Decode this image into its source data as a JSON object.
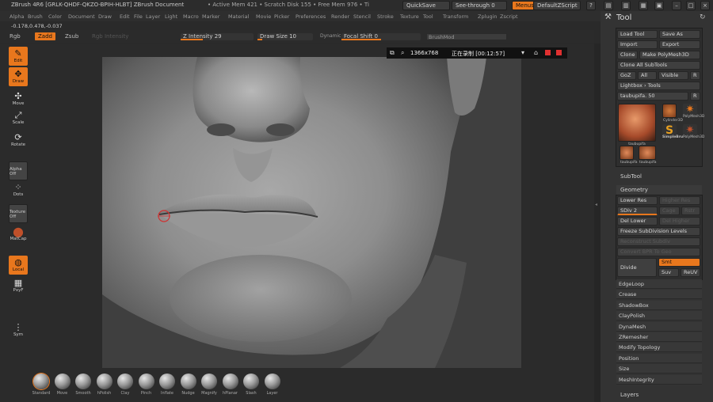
{
  "titlebar": {
    "title": "ZBrush 4R6 [GRLK-QHDF-QKZO-BPIH-HLBT]   ZBrush Document",
    "stats": "• Active Mem 421 • Scratch Disk 155 • Free Mem 976 • Ti",
    "quicksave": "QuickSave",
    "seethrough": "See-through  0",
    "menus": "Menus",
    "script": "DefaultZScript"
  },
  "menubar": [
    "Alpha",
    "Brush",
    "Color",
    "Document",
    "Draw",
    "Edit",
    "File",
    "Layer",
    "Light",
    "Macro",
    "Marker",
    "Material",
    "Movie",
    "Picker",
    "Preferences",
    "Render",
    "Stencil",
    "Stroke",
    "Texture",
    "Tool",
    "Transform",
    "Zplugin",
    "Zscript"
  ],
  "coords": "-0.178,0.478,-0.037",
  "toolbar2": {
    "rgb": "Rgb",
    "zadd": "Zadd",
    "zsub": "Zsub",
    "rgb_intensity": "Rgb Intensity",
    "z_intensity": "Z Intensity 29",
    "draw_size": "Draw Size 10",
    "dynamic": "Dynamic",
    "focal_shift": "Focal Shift 0",
    "brush_input": "BrushMod"
  },
  "leftshelf": [
    {
      "label": "Edit",
      "icon": "edit-icon",
      "icon_char": "✎",
      "active": true
    },
    {
      "label": "Draw",
      "icon": "draw-icon",
      "icon_char": "✥",
      "active": true
    },
    {
      "label": "Move",
      "icon": "move-icon",
      "icon_char": "✣",
      "active": false
    },
    {
      "label": "Scale",
      "icon": "scale-icon",
      "icon_char": "⤢",
      "active": false
    },
    {
      "label": "Rotate",
      "icon": "rotate-icon",
      "icon_char": "⟳",
      "active": false
    },
    {
      "label": "Alpha Off",
      "icon": "alpha-icon",
      "icon_char": "",
      "active": false
    },
    {
      "label": "Dots",
      "icon": "dots-icon",
      "icon_char": "⁘",
      "active": false
    },
    {
      "label": "Texture Off",
      "icon": "texture-icon",
      "icon_char": "",
      "active": false
    },
    {
      "label": "MatCap",
      "icon": "matcap-icon",
      "icon_char": "●",
      "active": false
    },
    {
      "label": "Local",
      "icon": "local-icon",
      "icon_char": "◍",
      "active": true
    },
    {
      "label": "PxyF",
      "icon": "grid-icon",
      "icon_char": "▦",
      "active": false
    },
    {
      "label": "Sym",
      "icon": "sym-icon",
      "icon_char": "⋮",
      "active": false
    }
  ],
  "recorder": {
    "resolution": "1366x768",
    "status": "正在录制 [00:12:57]"
  },
  "bottomshelf": [
    "Standard",
    "Move",
    "Smooth",
    "hPolish",
    "Clay",
    "Pinch",
    "Inflate",
    "Nudge",
    "Magnify",
    "hPlanar",
    "Slash",
    "Layer"
  ],
  "rightpanel": {
    "title": "Tool",
    "load_tool": "Load Tool",
    "save_as": "Save As",
    "import": "Import",
    "export": "Export",
    "clone": "Clone",
    "make_polymesh": "Make PolyMesh3D",
    "clone_all": "Clone All SubTools",
    "goz": "GoZ",
    "all": "All",
    "visible": "Visible",
    "r": "R",
    "lightbox_tools": "Lightbox › Tools",
    "current_tool": "taubupifa. 50",
    "thumbs": [
      "taubupifa",
      "Cylinder3D",
      "PolyMesh3D",
      "SimpleBrush",
      "PolyMesh3D",
      "taubupifa",
      "taubupifa"
    ],
    "subtool": "SubTool",
    "geometry": "Geometry",
    "lower_res": "Lower Res",
    "higher_res": "Higher Res",
    "sdiv": "SDiv 2",
    "cage": "Cage",
    "rstr": "Rstr",
    "del_lower": "Del Lower",
    "del_higher": "Del Higher",
    "freeze": "Freeze SubDivision Levels",
    "reconstruct": "Reconstruct Subdiv",
    "convert_bpr": "Convert BPR To Geo",
    "divide": "Divide",
    "smt": "Smt",
    "suv": "Suv",
    "reuv": "ReUV",
    "sections": [
      "EdgeLoop",
      "Crease",
      "ShadowBox",
      "ClayPolish",
      "DynaMesh",
      "ZRemesher",
      "Modify Topology",
      "Position",
      "Size",
      "MeshIntegrity"
    ],
    "layers": "Layers"
  },
  "colors": {
    "accent": "#e8771d",
    "panel": "#333333",
    "bg": "#2a2a2a"
  }
}
